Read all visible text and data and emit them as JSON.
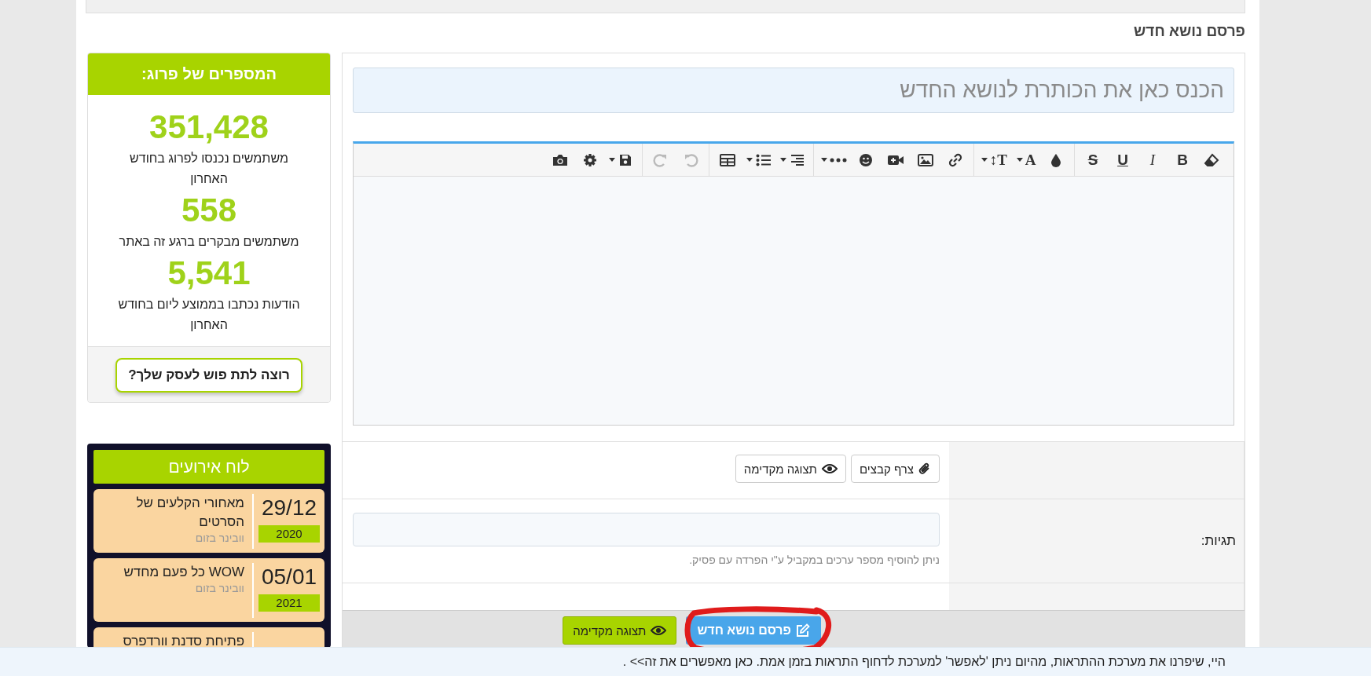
{
  "page_title": "פרסם נושא חדש",
  "stats": {
    "title": "המספרים של פרוג:",
    "items": [
      {
        "number": "351,428",
        "caption": "משתמשים נכנסו לפרוג בחודש האחרון"
      },
      {
        "number": "558",
        "caption": "משתמשים מבקרים ברגע זה באתר"
      },
      {
        "number": "5,541",
        "caption": "הודעות נכתבו בממוצע ליום בחודש האחרון"
      }
    ],
    "button": "רוצה לתת פוש לעסק שלך?"
  },
  "events": {
    "title": "לוח אירועים",
    "items": [
      {
        "date": "29/12",
        "year": "2020",
        "title": "מאחורי הקלעים של הסרטים",
        "subtitle": "וובינר בזום"
      },
      {
        "date": "05/01",
        "year": "2021",
        "title": "WOW כל פעם מחדש",
        "subtitle": "וובינר בזום"
      },
      {
        "title": "פתיחת סדנת וורדפרס"
      }
    ]
  },
  "title_field": {
    "placeholder": "הכנס כאן את הכותרת לנושא החדש"
  },
  "toolbar": [
    [
      {
        "kind": "eraser",
        "caret": false,
        "disabled": false
      },
      {
        "kind": "bold",
        "label": "B",
        "caret": false,
        "disabled": false
      },
      {
        "kind": "italic",
        "label": "I",
        "caret": false,
        "disabled": false
      },
      {
        "kind": "underline",
        "label": "U",
        "caret": false,
        "disabled": false
      },
      {
        "kind": "strike",
        "label": "S",
        "caret": false,
        "disabled": false
      }
    ],
    [
      {
        "kind": "color",
        "caret": false,
        "disabled": false
      },
      {
        "kind": "fontcolor",
        "label": "A",
        "caret": true,
        "disabled": false
      },
      {
        "kind": "fontsize",
        "label": "T↕",
        "caret": true,
        "disabled": false
      }
    ],
    [
      {
        "kind": "link",
        "caret": false,
        "disabled": false
      },
      {
        "kind": "image",
        "caret": false,
        "disabled": false
      },
      {
        "kind": "video",
        "caret": false,
        "disabled": false
      },
      {
        "kind": "emoji",
        "caret": false,
        "disabled": false
      },
      {
        "kind": "more",
        "caret": true,
        "disabled": false
      }
    ],
    [
      {
        "kind": "align",
        "caret": true,
        "disabled": false
      },
      {
        "kind": "list",
        "caret": true,
        "disabled": false
      },
      {
        "kind": "table",
        "caret": false,
        "disabled": false
      }
    ],
    [
      {
        "kind": "undo",
        "caret": false,
        "disabled": true
      },
      {
        "kind": "redo",
        "caret": false,
        "disabled": true
      }
    ],
    [
      {
        "kind": "save",
        "caret": true,
        "disabled": false
      },
      {
        "kind": "settings",
        "caret": false,
        "disabled": false
      },
      {
        "kind": "camera",
        "caret": false,
        "disabled": false
      }
    ]
  ],
  "attach_button": "צרף קבצים",
  "preview_button": "תצוגה מקדימה",
  "tags": {
    "label": "תגיות:",
    "hint": "ניתן להוסיף מספר ערכים במקביל ע\"י הפרדה עם פסיק."
  },
  "actions": {
    "publish": "פרסם נושא חדש",
    "preview": "תצוגה מקדימה"
  },
  "notice": "היי, שיפרנו את מערכת ההתראות, מהיום ניתן 'לאפשר' למערכת לדחוף התראות בזמן אמת. כאן מאפשרים את זה>> ."
}
